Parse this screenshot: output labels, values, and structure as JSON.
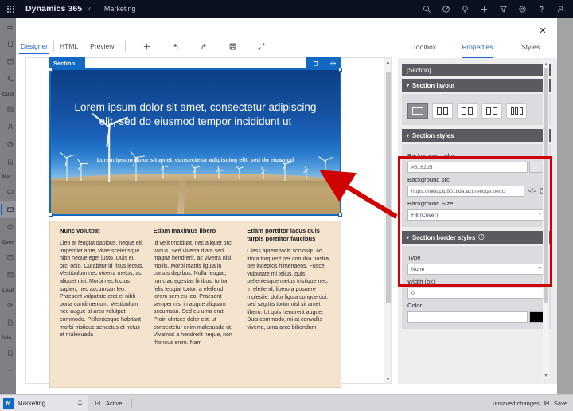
{
  "topnav": {
    "waffle_icon": "app-launcher-icon",
    "brand": "Dynamics 365",
    "brand_caret": "˅",
    "app_name": "Marketing",
    "icons": [
      {
        "name": "search-icon",
        "glyph": "search"
      },
      {
        "name": "diagnostics-icon",
        "glyph": "target"
      },
      {
        "name": "lightbulb-icon",
        "glyph": "bulb"
      },
      {
        "name": "add-icon",
        "glyph": "plus"
      },
      {
        "name": "filter-icon",
        "glyph": "funnel"
      },
      {
        "name": "settings-icon",
        "glyph": "gear"
      },
      {
        "name": "help-icon",
        "glyph": "question"
      },
      {
        "name": "account-icon",
        "glyph": "person"
      }
    ]
  },
  "rail": {
    "menu_label": "hamburger",
    "groups": [
      {
        "label": "",
        "items": [
          "page-icon",
          "calendar-icon",
          "phone-icon"
        ]
      },
      {
        "label": "Cust",
        "items": [
          "contact-card-icon",
          "person-icon",
          "pie-chart-icon",
          "segment-icon"
        ]
      },
      {
        "label": "Mar",
        "items": [
          "message-icon",
          "email-icon",
          "smiley-icon"
        ]
      },
      {
        "label": "Even",
        "items": [
          "calendar-icon",
          "calendar-icon"
        ]
      },
      {
        "label": "Lead",
        "items": [
          "score-icon",
          "lead-icon"
        ]
      },
      {
        "label": "Inte",
        "items": [
          "form-icon"
        ]
      }
    ],
    "selected": "email-icon"
  },
  "dialog": {
    "close_label": "✕"
  },
  "editor_toolbar": {
    "tabs": [
      {
        "label": "Designer",
        "active": true
      },
      {
        "label": "HTML",
        "active": false
      },
      {
        "label": "Preview",
        "active": false
      }
    ],
    "buttons": [
      {
        "name": "add-element-button",
        "glyph": "plus"
      },
      {
        "name": "undo-button",
        "glyph": "undo"
      },
      {
        "name": "redo-button",
        "glyph": "redo"
      },
      {
        "name": "save-button",
        "glyph": "save"
      },
      {
        "name": "expand-button",
        "glyph": "expand"
      }
    ]
  },
  "canvas": {
    "section_tab_label": "Section",
    "section_tools": [
      {
        "name": "delete-section-icon",
        "glyph": "trash"
      },
      {
        "name": "move-section-icon",
        "glyph": "move"
      }
    ],
    "hero": {
      "headline": "Lorem ipsum dolor sit amet, consectetur adipiscing elit, sed do eiusmod tempor incididunt ut",
      "subhead": "Lorem ipsum dolor sit amet, consectetur adipiscing elit, sed do eiusmod",
      "image_alt": "wind-turbine-field-photo"
    },
    "columns": [
      {
        "heading": "Nunc volutpat",
        "body": "Lleo at feugiat dapibus, neque elit imperdiet ante, vitae scelerisque nibh neque eget justo. Duis eu orci odio. Curabitur id risus lectus. Vestibulum nec viverra metus, ac aliquet nisi. Morbi nec luctus sapien, nec accumsan leo. Praesent vulputate erat et nibh porta condimentum. Vestibulum nec augue at arcu volutpat commodo. Pellentesque habitant morbi tristique senectus et netus et malesuada"
      },
      {
        "heading": "Etiam maximus libero",
        "body": "Id velit tincidunt, nec aliquet orci varius. Sed viverra diam sed magna hendrerit, ac viverra nisl mollis. Morbi mattis ligula in cursus dapibus. Nulla feugiat, nunc ac egestas finibus, tortor felis feugiat tortor, a eleifend lorem sem eu leo. Praesent semper nisl in augue aliquam accumsan. Sed eu urna erat. Proin ultrices dolor est, ut consectetur enim malesuada ut. Vivamus a hendrerit neque, non rhoncus enim. Nam"
      },
      {
        "heading": "Etiam porttitor lacus quis turpis porttitor faucibus",
        "body": "Class aptent taciti sociosqu ad litora torquent per conubia nostra, per inceptos himenaeos. Fusce vulputate mi tellus, quis pellentesque metus tristique nec. In eleifend, libero a posuere molestie, dolor ligula congue dui, sed sagittis tortor nisl sit amet libero. Ut quis hendrerit augue. Duis commodo, mi at convallis viverra, urna ante bibendum"
      }
    ]
  },
  "properties_panel": {
    "tabs": [
      {
        "label": "Toolbox",
        "active": false
      },
      {
        "label": "Properties",
        "active": true
      },
      {
        "label": "Styles",
        "active": false
      }
    ],
    "element_name": "[Section]",
    "section_layout": {
      "title": "Section layout",
      "collapse_glyph": "▾",
      "options": [
        {
          "name": "layout-1-column",
          "columns": 1,
          "selected": true
        },
        {
          "name": "layout-2-column-equal",
          "columns": 2,
          "selected": false
        },
        {
          "name": "layout-2-column-narrow-wide",
          "columns": 2,
          "selected": false
        },
        {
          "name": "layout-2-column-wide-narrow",
          "columns": 2,
          "selected": false
        },
        {
          "name": "layout-3-column",
          "columns": 3,
          "selected": false
        }
      ]
    },
    "section_styles": {
      "title": "Section styles",
      "collapse_glyph": "▾",
      "background_color_label": "Background color",
      "background_color_value": "#3162d5",
      "background_src_label": "Background src",
      "background_src_value": "https://mktdplp901tida.azureedge.net/c",
      "background_src_code_icon": "</>",
      "background_src_file_icon": "file-picker-icon",
      "background_size_label": "Background Size",
      "background_size_value": "Fill (Cover)",
      "dropdown_glyph": "˅"
    },
    "section_border_styles": {
      "title": "Section border styles",
      "info_glyph": "ⓘ",
      "collapse_glyph": "▾",
      "type_label": "Type",
      "type_value": "None",
      "width_label": "Width (px)",
      "width_value": "0",
      "color_label": "Color",
      "dropdown_glyph": "˅"
    }
  },
  "annotation": {
    "highlight_color": "#d00000",
    "arrow_name": "red-callout-arrow",
    "box_name": "red-highlight-box"
  },
  "statusbar": {
    "app_badge": "M",
    "app_name": "Marketing",
    "state_icon": "record-status-icon",
    "state_label": "Active",
    "unsaved_label": "unsaved changes",
    "save_label": "Save",
    "save_icon": "save-icon"
  }
}
